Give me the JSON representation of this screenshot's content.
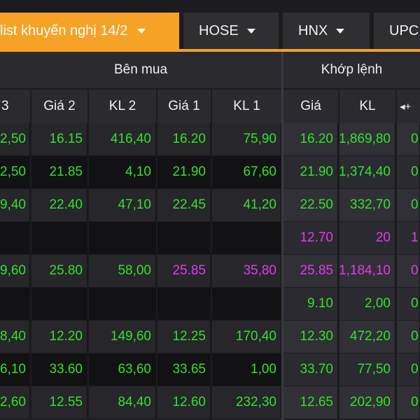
{
  "tabs": [
    {
      "label": "list khuyến nghị 14/2",
      "active": true
    },
    {
      "label": "HOSE"
    },
    {
      "label": "HNX"
    },
    {
      "label": "UPC"
    }
  ],
  "headers": {
    "buy_group": "Bên mua",
    "match_group": "Khớp lệnh",
    "columns": [
      "3",
      "Giá 2",
      "KL 2",
      "Giá 1",
      "KL 1",
      "Giá",
      "KL"
    ],
    "scroll_symbol": "◂+"
  },
  "rows": [
    {
      "c": [
        "2,50",
        "16.15",
        "416,40",
        "16.20",
        "75,90",
        "16.20",
        "1,869,80",
        "0"
      ],
      "cls": [
        "g",
        "g",
        "g",
        "g",
        "g",
        "g",
        "g",
        "g"
      ]
    },
    {
      "c": [
        "2,50",
        "21.85",
        "4,10",
        "21.90",
        "67,60",
        "21.90",
        "1,374,40",
        "0"
      ],
      "cls": [
        "g",
        "g",
        "g",
        "g",
        "g",
        "g",
        "g",
        "g"
      ]
    },
    {
      "c": [
        "9,40",
        "22.40",
        "47,10",
        "22.45",
        "41,20",
        "22.50",
        "332,70",
        "0"
      ],
      "cls": [
        "g",
        "g",
        "g",
        "g",
        "g",
        "g",
        "g",
        "g"
      ]
    },
    {
      "c": [
        "",
        "",
        "",
        "",
        "",
        "12.70",
        "20",
        "1"
      ],
      "cls": [
        "g",
        "g",
        "g",
        "g",
        "g",
        "p",
        "p",
        "p"
      ]
    },
    {
      "c": [
        "9,60",
        "25.80",
        "58,00",
        "25.85",
        "35,80",
        "25.85",
        "1,184,10",
        "0"
      ],
      "cls": [
        "g",
        "g",
        "g",
        "p",
        "p",
        "p",
        "p",
        "p"
      ]
    },
    {
      "c": [
        "",
        "",
        "",
        "",
        "",
        "9.10",
        "2,00",
        "0"
      ],
      "cls": [
        "g",
        "g",
        "g",
        "g",
        "g",
        "g",
        "g",
        "g"
      ]
    },
    {
      "c": [
        "8,40",
        "12.20",
        "149,60",
        "12.25",
        "170,40",
        "12.30",
        "472,20",
        "0"
      ],
      "cls": [
        "g",
        "g",
        "g",
        "g",
        "g",
        "g",
        "g",
        "g"
      ]
    },
    {
      "c": [
        "6,10",
        "33.60",
        "63,60",
        "33.65",
        "1,00",
        "33.70",
        "77,50",
        "0"
      ],
      "cls": [
        "g",
        "g",
        "g",
        "g",
        "g",
        "g",
        "g",
        "g"
      ]
    },
    {
      "c": [
        "2,60",
        "12.55",
        "84,40",
        "12.60",
        "232,30",
        "12.65",
        "202,90",
        "0"
      ],
      "cls": [
        "g",
        "g",
        "g",
        "g",
        "g",
        "g",
        "g",
        "g"
      ]
    }
  ]
}
